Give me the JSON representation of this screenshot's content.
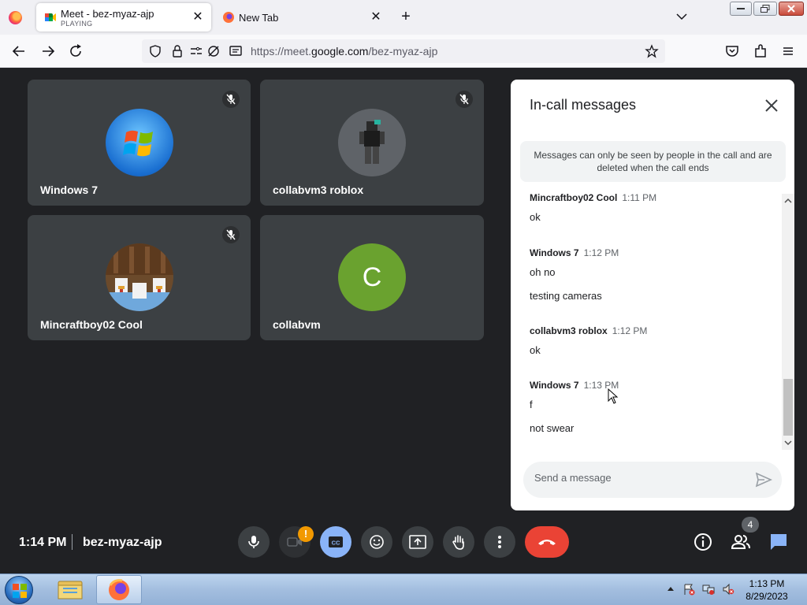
{
  "browser": {
    "tabs": [
      {
        "title": "Meet - bez-myaz-ajp",
        "subtitle": "PLAYING",
        "active": true
      },
      {
        "title": "New Tab",
        "active": false
      }
    ],
    "url_prefix": "https://meet.",
    "url_domain": "google.com",
    "url_path": "/bez-myaz-ajp"
  },
  "meeting": {
    "participants": [
      {
        "name": "Windows 7",
        "muted": true
      },
      {
        "name": "collabvm3 roblox",
        "muted": true
      },
      {
        "name": "Mincraftboy02 Cool",
        "muted": true
      },
      {
        "name": "collabvm",
        "initial": "C",
        "muted": false,
        "avatar_color": "#6aa22f"
      }
    ],
    "time": "1:14 PM",
    "code": "bez-myaz-ajp",
    "people_count": "4",
    "camera_warning": "!"
  },
  "chat": {
    "title": "In-call messages",
    "notice": "Messages can only be seen by people in the call and are deleted when the call ends",
    "messages": [
      {
        "sender": "Mincraftboy02 Cool",
        "time": "1:11 PM",
        "texts": [
          "ok"
        ]
      },
      {
        "sender": "Windows 7",
        "time": "1:12 PM",
        "texts": [
          "oh no",
          "testing cameras"
        ]
      },
      {
        "sender": "collabvm3 roblox",
        "time": "1:12 PM",
        "texts": [
          "ok"
        ]
      },
      {
        "sender": "Windows 7",
        "time": "1:13 PM",
        "texts": [
          "f",
          "not swear"
        ]
      }
    ],
    "input_placeholder": "Send a message"
  },
  "taskbar": {
    "time": "1:13 PM",
    "date": "8/29/2023"
  },
  "colors": {
    "meet_bg": "#202124",
    "tile_bg": "#3c4043",
    "end_call": "#ea4335",
    "cc_active": "#8ab4f8",
    "chat_active": "#8ab4f8"
  }
}
